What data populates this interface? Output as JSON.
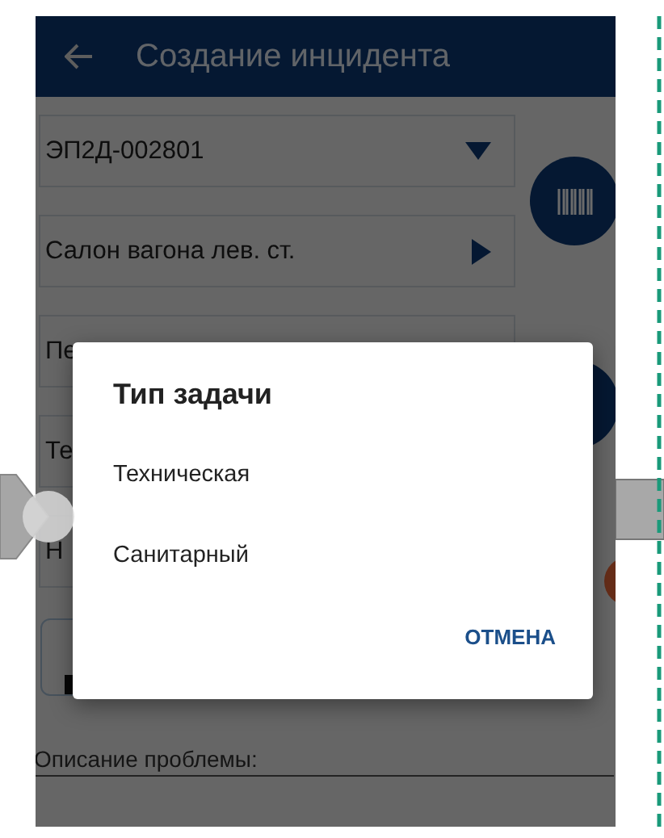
{
  "header": {
    "title": "Создание инцидента"
  },
  "fields": [
    {
      "kind": "dropdown",
      "value": "ЭП2Д-002801"
    },
    {
      "kind": "link",
      "value": "Салон вагона лев. ст."
    },
    {
      "kind": "text",
      "value": "Пе"
    },
    {
      "kind": "text",
      "value": "Те"
    },
    {
      "kind": "text",
      "value": "Н"
    }
  ],
  "description_label": "Описание проблемы:",
  "dialog": {
    "title": "Тип задачи",
    "options": [
      "Техническая",
      "Санитарный"
    ],
    "button": "ОТМЕНА"
  }
}
